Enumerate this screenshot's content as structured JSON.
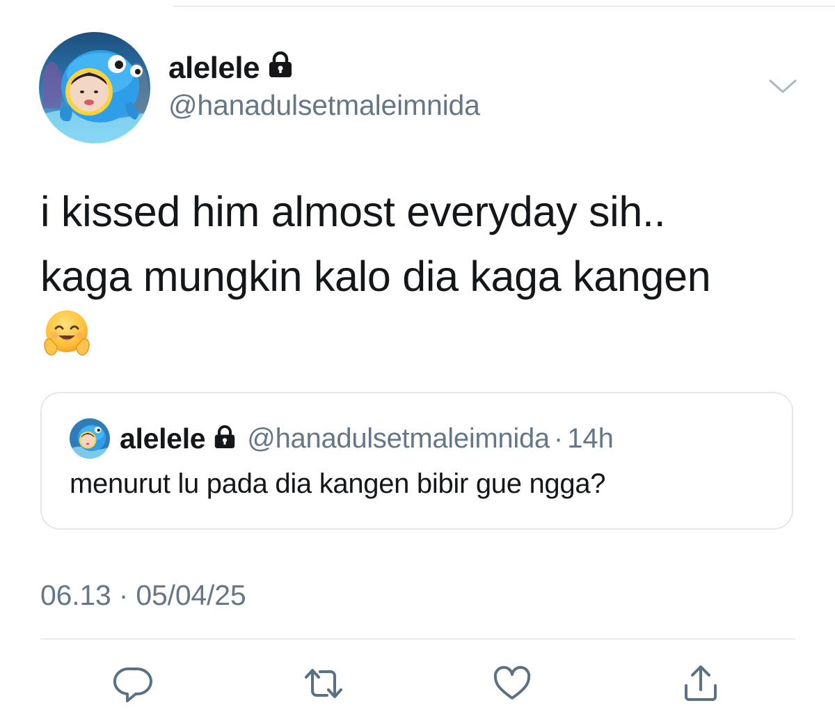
{
  "tweet": {
    "author": {
      "display_name": "alelele",
      "handle": "@hanadulsetmaleimnida",
      "protected": true
    },
    "text": "i kissed him almost everyday sih..\nkaga mungkin kalo dia kaga kangen",
    "emoji": "hugging-face",
    "timestamp": "06.13 · 05/04/25",
    "quoted_tweet": {
      "display_name": "alelele",
      "handle": "@hanadulsetmaleimnida",
      "separator": "·",
      "time": "14h",
      "text": "menurut lu pada dia kangen bibir gue ngga?"
    },
    "actions": {
      "reply": "reply-icon",
      "retweet": "retweet-icon",
      "like": "heart-icon",
      "share": "share-icon"
    }
  },
  "colors": {
    "text": "#14171a",
    "secondary": "#657786",
    "icon": "#5b7083",
    "divider": "#e6ecf0",
    "card_border": "#e1e8ed"
  }
}
